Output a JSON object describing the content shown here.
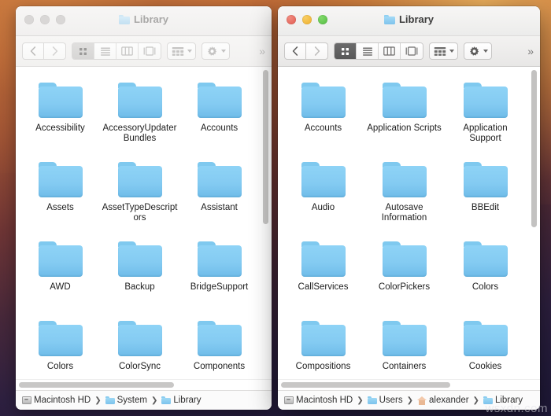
{
  "desktop": {
    "watermark": "wsxdn.com"
  },
  "windows": [
    {
      "id": "system-library",
      "state": "inactive",
      "title": "Library",
      "title_icon": "folder-icon",
      "traffic_lights": {
        "close": "close-button",
        "minimize": "minimize-button",
        "zoom": "zoom-button"
      },
      "toolbar": {
        "back": "‹",
        "forward": "›",
        "view_icon_label": "icon-view",
        "view_list_label": "list-view",
        "view_column_label": "column-view",
        "view_gallery_label": "gallery-view",
        "selected_view": "icon-view",
        "arrange_label": "arrange-by",
        "action_label": "action-gear",
        "overflow": "»"
      },
      "items": [
        "Accessibility",
        "AccessoryUpdaterBundles",
        "Accounts",
        "Assets",
        "AssetTypeDescriptors",
        "Assistant",
        "AWD",
        "Backup",
        "BridgeSupport",
        "Colors",
        "ColorSync",
        "Components"
      ],
      "path": [
        {
          "label": "Macintosh HD",
          "icon": "hard-disk-icon"
        },
        {
          "label": "System",
          "icon": "folder-icon"
        },
        {
          "label": "Library",
          "icon": "folder-icon"
        }
      ],
      "path_separator": "❯"
    },
    {
      "id": "user-library",
      "state": "active",
      "title": "Library",
      "title_icon": "folder-icon",
      "traffic_lights": {
        "close": "close-button",
        "minimize": "minimize-button",
        "zoom": "zoom-button"
      },
      "toolbar": {
        "back": "‹",
        "forward": "›",
        "view_icon_label": "icon-view",
        "view_list_label": "list-view",
        "view_column_label": "column-view",
        "view_gallery_label": "gallery-view",
        "selected_view": "icon-view",
        "arrange_label": "arrange-by",
        "action_label": "action-gear",
        "overflow": "»"
      },
      "items": [
        "Accounts",
        "Application Scripts",
        "Application Support",
        "Audio",
        "Autosave Information",
        "BBEdit",
        "CallServices",
        "ColorPickers",
        "Colors",
        "Compositions",
        "Containers",
        "Cookies"
      ],
      "path": [
        {
          "label": "Macintosh HD",
          "icon": "hard-disk-icon"
        },
        {
          "label": "Users",
          "icon": "folder-icon"
        },
        {
          "label": "alexander",
          "icon": "home-icon"
        },
        {
          "label": "Library",
          "icon": "folder-icon"
        }
      ],
      "path_separator": "❯"
    }
  ],
  "colors": {
    "folder_blue": "#84cbf2",
    "traffic_red": "#e1594e",
    "traffic_yellow": "#eeaf2c",
    "traffic_green": "#53bb41",
    "desktop_top": "#d4813f",
    "desktop_bottom": "#1e1838"
  }
}
